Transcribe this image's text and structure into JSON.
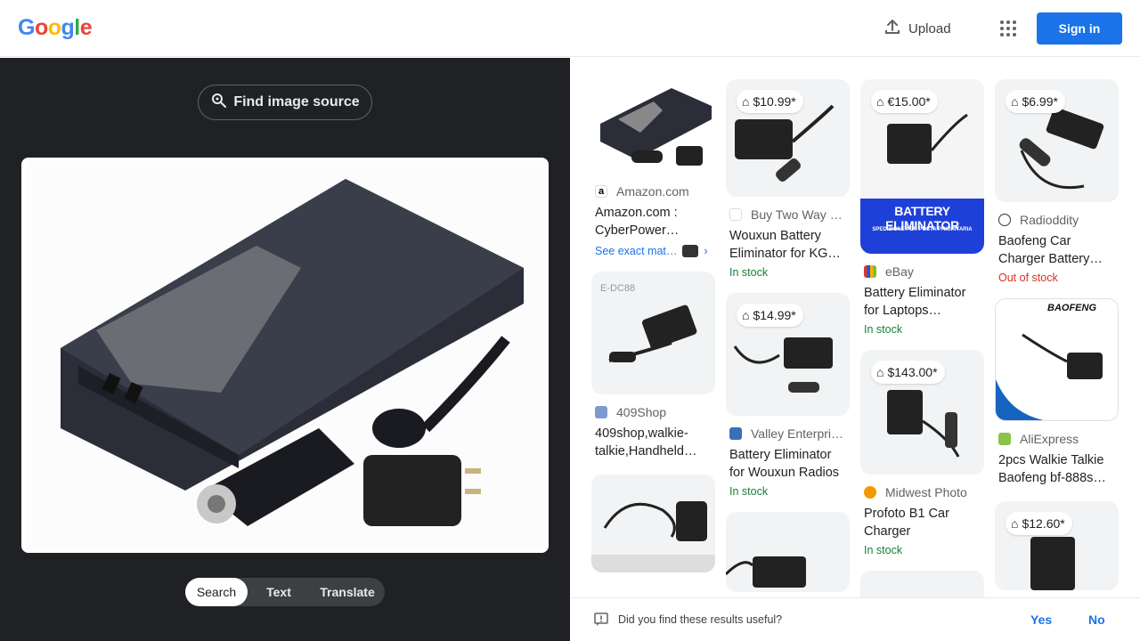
{
  "header": {
    "logo": [
      "G",
      "o",
      "o",
      "g",
      "l",
      "e"
    ],
    "logo_colors": [
      "#4285f4",
      "#ea4335",
      "#fbbc05",
      "#4285f4",
      "#34a853",
      "#ea4335"
    ],
    "upload_label": "Upload",
    "signin_label": "Sign in"
  },
  "left": {
    "find_source_label": "Find image source",
    "tabs": [
      "Search",
      "Text",
      "Translate"
    ],
    "active_tab": "Search"
  },
  "results": {
    "columns": [
      [
        {
          "source": "Amazon.com",
          "title": "Amazon.com : CyberPower…",
          "exact_label": "See exact mat…",
          "img": "inverter"
        },
        {
          "source": "409Shop",
          "title": "409shop,walkie-talkie,Handheld…",
          "img": "edc88"
        },
        {
          "img": "cable"
        }
      ],
      [
        {
          "price": "$10.99*",
          "source": "Buy Two Way …",
          "title": "Wouxun Battery Eliminator for KG…",
          "stock": "In stock",
          "img": "elim1"
        },
        {
          "price": "$14.99*",
          "source": "Valley Enterpri…",
          "title": "Battery Eliminator for Wouxun Radios",
          "stock": "In stock",
          "img": "elim2"
        },
        {
          "img": "cable2"
        }
      ],
      [
        {
          "price": "€15.00*",
          "source": "eBay",
          "title": "Battery Eliminator for Laptops…",
          "stock": "In stock",
          "img": "ebay",
          "banner": "BATTERY ELIMINATOR",
          "banner_sub": "SPEDIZIONE PER POSTA PRIORITARIA"
        },
        {
          "price": "$143.00*",
          "source": "Midwest Photo",
          "title": "Profoto B1 Car Charger",
          "stock": "In stock",
          "img": "profoto"
        },
        {
          "img": "blank"
        }
      ],
      [
        {
          "price": "$6.99*",
          "source": "Radioddity",
          "title": "Baofeng Car Charger Battery…",
          "stock": "Out of stock",
          "stock_out": true,
          "img": "baofeng1"
        },
        {
          "source": "AliExpress",
          "title": "2pcs Walkie Talkie Baofeng bf-888s…",
          "img": "baofeng2",
          "brand": "BAOFENG"
        },
        {
          "price": "$12.60*",
          "img": "elim3"
        }
      ]
    ]
  },
  "feedback": {
    "question": "Did you find these results useful?",
    "yes": "Yes",
    "no": "No"
  }
}
